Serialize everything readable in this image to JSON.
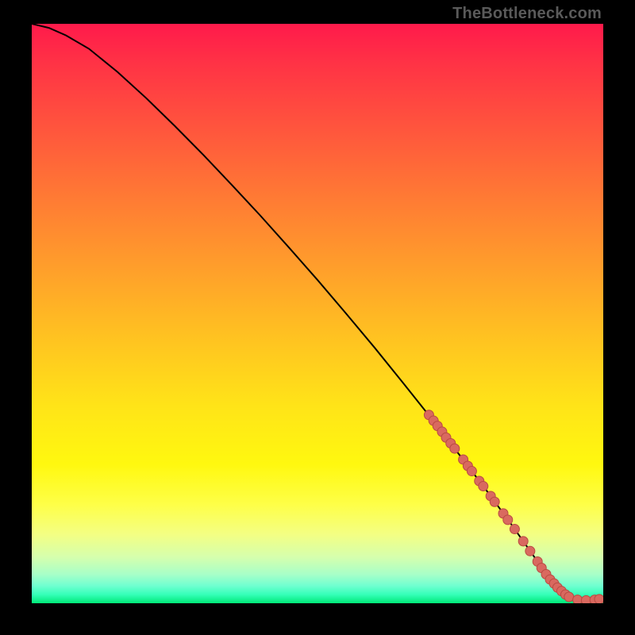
{
  "watermark": "TheBottleneck.com",
  "colors": {
    "line": "#000000",
    "marker_fill": "#d9695f",
    "marker_stroke": "#b94a42"
  },
  "chart_data": {
    "type": "line",
    "title": "",
    "xlabel": "",
    "ylabel": "",
    "xlim": [
      0,
      100
    ],
    "ylim": [
      0,
      100
    ],
    "grid": false,
    "series": [
      {
        "name": "bottleneck-curve",
        "x": [
          0,
          3,
          6,
          10,
          15,
          20,
          25,
          30,
          35,
          40,
          45,
          50,
          55,
          60,
          65,
          70,
          75,
          80,
          82,
          84,
          86,
          88,
          90,
          92,
          94,
          96,
          98,
          100
        ],
        "y": [
          100,
          99.3,
          98.0,
          95.7,
          91.7,
          87.2,
          82.4,
          77.4,
          72.2,
          66.9,
          61.4,
          55.8,
          50.0,
          44.1,
          38.0,
          31.8,
          25.4,
          18.9,
          16.2,
          13.5,
          10.7,
          7.9,
          5.0,
          2.7,
          1.1,
          0.4,
          0.5,
          0.8
        ]
      }
    ],
    "markers": {
      "name": "highlighted-points",
      "points": [
        {
          "x": 69.5,
          "y": 32.5
        },
        {
          "x": 70.3,
          "y": 31.5
        },
        {
          "x": 71.0,
          "y": 30.6
        },
        {
          "x": 71.8,
          "y": 29.6
        },
        {
          "x": 72.5,
          "y": 28.6
        },
        {
          "x": 73.3,
          "y": 27.6
        },
        {
          "x": 74.0,
          "y": 26.7
        },
        {
          "x": 75.5,
          "y": 24.8
        },
        {
          "x": 76.3,
          "y": 23.7
        },
        {
          "x": 77.0,
          "y": 22.8
        },
        {
          "x": 78.3,
          "y": 21.1
        },
        {
          "x": 79.0,
          "y": 20.2
        },
        {
          "x": 80.3,
          "y": 18.5
        },
        {
          "x": 81.0,
          "y": 17.5
        },
        {
          "x": 82.5,
          "y": 15.5
        },
        {
          "x": 83.3,
          "y": 14.4
        },
        {
          "x": 84.5,
          "y": 12.8
        },
        {
          "x": 86.0,
          "y": 10.7
        },
        {
          "x": 87.2,
          "y": 9.0
        },
        {
          "x": 88.5,
          "y": 7.2
        },
        {
          "x": 89.2,
          "y": 6.1
        },
        {
          "x": 90.0,
          "y": 5.0
        },
        {
          "x": 90.7,
          "y": 4.1
        },
        {
          "x": 91.4,
          "y": 3.4
        },
        {
          "x": 92.0,
          "y": 2.7
        },
        {
          "x": 92.7,
          "y": 2.1
        },
        {
          "x": 93.4,
          "y": 1.5
        },
        {
          "x": 94.0,
          "y": 1.1
        },
        {
          "x": 95.5,
          "y": 0.6
        },
        {
          "x": 97.0,
          "y": 0.5
        },
        {
          "x": 98.5,
          "y": 0.6
        },
        {
          "x": 99.3,
          "y": 0.7
        }
      ]
    }
  }
}
